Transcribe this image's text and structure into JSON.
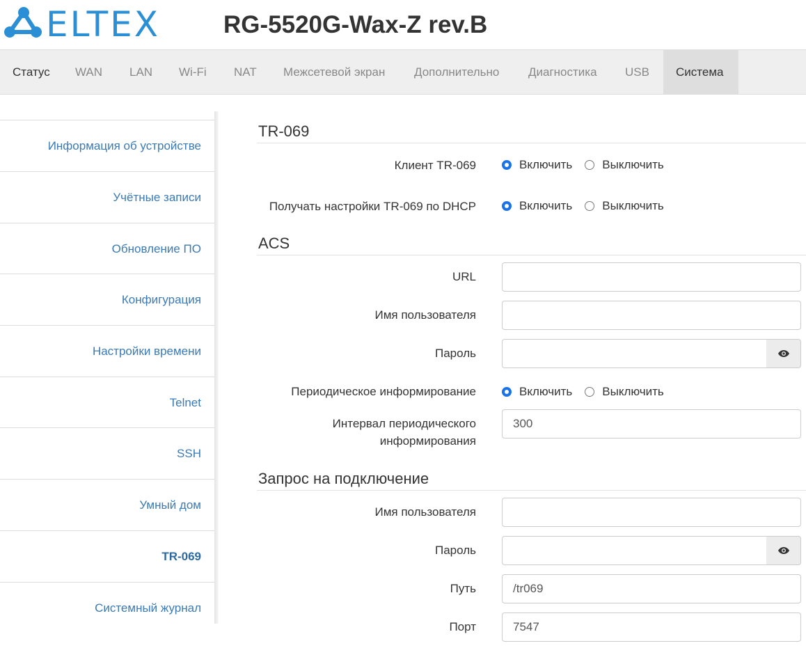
{
  "header": {
    "logo_text": "ELTEX",
    "device_title": "RG-5520G-Wax-Z rev.B"
  },
  "topnav": [
    {
      "label": "Статус"
    },
    {
      "label": "WAN"
    },
    {
      "label": "LAN"
    },
    {
      "label": "Wi-Fi"
    },
    {
      "label": "NAT"
    },
    {
      "label": "Межсетевой экран"
    },
    {
      "label": "Дополнительно"
    },
    {
      "label": "Диагностика"
    },
    {
      "label": "USB"
    },
    {
      "label": "Система"
    }
  ],
  "sidebar": [
    {
      "label": "Информация об устройстве"
    },
    {
      "label": "Учётные записи"
    },
    {
      "label": "Обновление ПО"
    },
    {
      "label": "Конфигурация"
    },
    {
      "label": "Настройки времени"
    },
    {
      "label": "Telnet"
    },
    {
      "label": "SSH"
    },
    {
      "label": "Умный дом"
    },
    {
      "label": "TR-069"
    },
    {
      "label": "Системный журнал"
    }
  ],
  "tr069": {
    "title": "TR-069",
    "client_label": "Клиент TR-069",
    "client_value": "Включить",
    "dhcp_label": "Получать настройки TR-069 по DHCP",
    "dhcp_value": "Включить"
  },
  "radio_options": {
    "on": "Включить",
    "off": "Выключить"
  },
  "acs": {
    "title": "ACS",
    "url_label": "URL",
    "url_value": "",
    "username_label": "Имя пользователя",
    "username_value": "",
    "password_label": "Пароль",
    "password_value": "",
    "periodic_label": "Периодическое информирование",
    "periodic_value": "Включить",
    "interval_label_line1": "Интервал периодического",
    "interval_label_line2": "информирования",
    "interval_value": "300"
  },
  "conn_request": {
    "title": "Запрос на подключение",
    "username_label": "Имя пользователя",
    "username_value": "",
    "password_label": "Пароль",
    "password_value": "",
    "path_label": "Путь",
    "path_value": "/tr069",
    "port_label": "Порт",
    "port_value": "7547"
  },
  "colors": {
    "accent": "#1a73e8",
    "link": "#3a7ab5",
    "logo": "#2b8fd6"
  }
}
